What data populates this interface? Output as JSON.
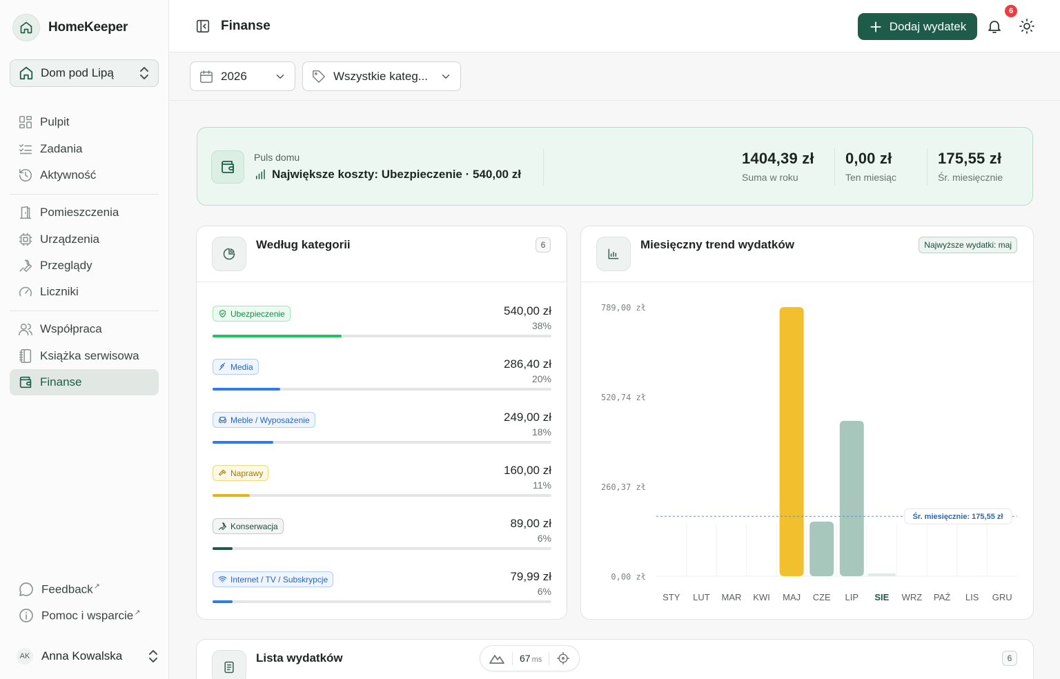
{
  "app": {
    "name": "HomeKeeper"
  },
  "home_selector": {
    "label": "Dom pod Lipą"
  },
  "nav": {
    "group1": [
      {
        "label": "Pulpit",
        "icon": "grid-icon"
      },
      {
        "label": "Zadania",
        "icon": "checklist-icon"
      },
      {
        "label": "Aktywność",
        "icon": "history-icon"
      }
    ],
    "group2": [
      {
        "label": "Pomieszczenia",
        "icon": "door-icon"
      },
      {
        "label": "Urządzenia",
        "icon": "chip-icon"
      },
      {
        "label": "Przeglądy",
        "icon": "wrench-icon"
      },
      {
        "label": "Liczniki",
        "icon": "gauge-icon"
      }
    ],
    "group3": [
      {
        "label": "Współpraca",
        "icon": "users-icon"
      },
      {
        "label": "Książka serwisowa",
        "icon": "notebook-icon"
      },
      {
        "label": "Finanse",
        "icon": "wallet-icon",
        "active": true
      }
    ],
    "bottom": [
      {
        "label": "Feedback",
        "icon": "chat-icon"
      },
      {
        "label": "Pomoc i wsparcie",
        "icon": "info-icon"
      }
    ]
  },
  "user": {
    "initials": "AK",
    "name": "Anna Kowalska"
  },
  "header": {
    "title": "Finanse",
    "add_label": "Dodaj wydatek",
    "notifications": "6"
  },
  "filters": {
    "year": "2026",
    "category": "Wszystkie kateg..."
  },
  "pulse": {
    "caption": "Puls domu",
    "headline": "Największe koszty: Ubezpieczenie · 540,00 zł",
    "stats": [
      {
        "value": "1404,39 zł",
        "label": "Suma w roku"
      },
      {
        "value": "0,00 zł",
        "label": "Ten miesiąc"
      },
      {
        "value": "175,55 zł",
        "label": "Śr. miesięcznie"
      }
    ]
  },
  "categories": {
    "title": "Według kategorii",
    "count": "6",
    "items": [
      {
        "name": "Ubezpieczenie",
        "amount": "540,00 zł",
        "percent": "38%",
        "share": 0.38,
        "color": "#22c35e",
        "chip_bg": "#eafbf0",
        "chip_border": "#a6e5bd",
        "chip_text": "#168a43",
        "icon": "shield-icon"
      },
      {
        "name": "Media",
        "amount": "286,40 zł",
        "percent": "20%",
        "share": 0.2,
        "color": "#2f7be8",
        "chip_bg": "#eef5fe",
        "chip_border": "#b1cdf6",
        "chip_text": "#2563c9",
        "icon": "plug-icon"
      },
      {
        "name": "Meble / Wyposażenie",
        "amount": "249,00 zł",
        "percent": "18%",
        "share": 0.18,
        "color": "#2f7be8",
        "chip_bg": "#eef5fe",
        "chip_border": "#b1cdf6",
        "chip_text": "#2563c9",
        "icon": "sofa-icon"
      },
      {
        "name": "Naprawy",
        "amount": "160,00 zł",
        "percent": "11%",
        "share": 0.11,
        "color": "#e6b512",
        "chip_bg": "#fef9e6",
        "chip_border": "#f1d878",
        "chip_text": "#a07a04",
        "icon": "hammer-icon"
      },
      {
        "name": "Konserwacja",
        "amount": "89,00 zł",
        "percent": "6%",
        "share": 0.06,
        "color": "#1e5b48",
        "chip_bg": "#f2f5f3",
        "chip_border": "#bfcbc5",
        "chip_text": "#1e4a3c",
        "icon": "wrench-icon"
      },
      {
        "name": "Internet / TV / Subskrypcje",
        "amount": "79,99 zł",
        "percent": "6%",
        "share": 0.06,
        "color": "#2f7be8",
        "chip_bg": "#eef5fe",
        "chip_border": "#b1cdf6",
        "chip_text": "#2563c9",
        "icon": "wifi-icon"
      }
    ]
  },
  "trend": {
    "title": "Miesięczny trend wydatków",
    "badge": "Najwyższe wydatki: maj",
    "avg_label": "Śr. miesięcznie: 175,55 zł"
  },
  "chart_data": {
    "type": "bar",
    "categories": [
      "STY",
      "LUT",
      "MAR",
      "KWI",
      "MAJ",
      "CZE",
      "LIP",
      "SIE",
      "WRZ",
      "PAŹ",
      "LIS",
      "GRU"
    ],
    "values": [
      0,
      0,
      0,
      0,
      789,
      160,
      455.39,
      0,
      0,
      0,
      0,
      0
    ],
    "ytick_labels": [
      "789,00 zł",
      "520,74 zł",
      "260,37 zł",
      "0,00 zł"
    ],
    "ylim": [
      0,
      789
    ],
    "average": 175.55,
    "highlight_month": "SIE",
    "colors": {
      "max": "#f2bf2e",
      "normal": "#a7c6bc",
      "current": "#e0ebe6"
    }
  },
  "expenses": {
    "title": "Lista wydatków",
    "count": "6"
  },
  "perf": {
    "value": "67",
    "unit": "ms"
  }
}
